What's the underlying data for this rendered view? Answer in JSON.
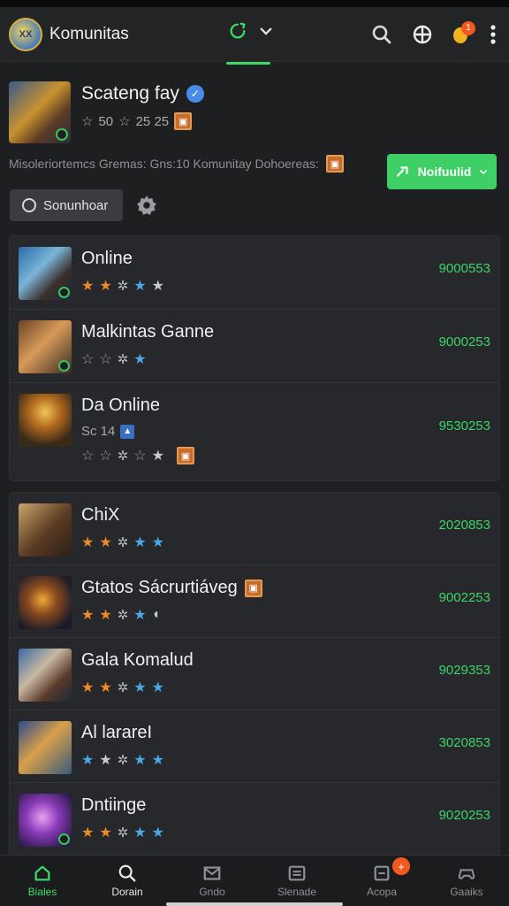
{
  "app": {
    "title": "Komunitas",
    "logo_text": "XX"
  },
  "header": {
    "notification_count": "1"
  },
  "profile": {
    "name": "Scateng fay",
    "stats_a": "50",
    "stats_b": "25 25",
    "follow_label": "Noifuulid"
  },
  "description": "Misoleriortemcs Gremas: Gns:10 Komunitay Dohoereas:",
  "filter": {
    "label": "Sonunhoar"
  },
  "list1": [
    {
      "name": "Online",
      "count": "9000553",
      "stars": [
        "orange",
        "orange",
        "gear",
        "blue",
        "gray"
      ],
      "badge": true,
      "thumb": "linear-gradient(135deg,#2a6aa8 0%,#7ab4d8 40%,#3a2e28 70%,#1d2a40 100%)"
    },
    {
      "name": "Malkintas Ganne",
      "count": "9000253",
      "stars": [
        "outline",
        "outline",
        "gear",
        "blue"
      ],
      "badge": true,
      "thumb": "linear-gradient(135deg,#6a4424 0%,#d89a5a 45%,#3a2a22 100%)"
    },
    {
      "name": "Da Online",
      "count": "9530253",
      "sub": "Sc 14",
      "stars": [
        "outline",
        "outline",
        "gear",
        "outline",
        "gray"
      ],
      "box": true,
      "thumb": "radial-gradient(circle at 50% 35%,#f2c35a 0%,#b26a1e 35%,#3a2a18 75%)"
    }
  ],
  "list2": [
    {
      "name": "ChiX",
      "count": "2020853",
      "stars": [
        "orange",
        "orange",
        "gear",
        "blue",
        "blue"
      ],
      "thumb": "linear-gradient(135deg,#c8a46a 0%,#5a3a22 55%,#2a2018 100%)"
    },
    {
      "name": "Gtatos Sácrurtiáveg",
      "count": "9002253",
      "stars": [
        "orange",
        "orange",
        "gear",
        "blue",
        "shield"
      ],
      "box": true,
      "thumb": "radial-gradient(circle at 45% 45%,#f0a83a 0%,#8a4a1e 35%,#1a1a2a 80%)"
    },
    {
      "name": "Gala Komalud",
      "count": "9029353",
      "stars": [
        "orange",
        "orange",
        "gear",
        "blue",
        "blue"
      ],
      "thumb": "linear-gradient(135deg,#3a6aa8 0%,#c8b8a0 40%,#5a3a2a 70%,#1a2a3a 100%)"
    },
    {
      "name": "Al larareI",
      "count": "3020853",
      "stars": [
        "blue",
        "gray",
        "gear",
        "blue",
        "blue"
      ],
      "thumb": "linear-gradient(135deg,#2a4a8a 0%,#d8a04a 45%,#3a5a7a 100%)"
    },
    {
      "name": "Dntiinge",
      "count": "9020253",
      "stars": [
        "orange",
        "orange",
        "gear",
        "blue",
        "blue"
      ],
      "badge": true,
      "thumb": "radial-gradient(circle at 45% 45%,#e8a0f0 0%,#8a3ab8 40%,#2a1a4a 85%)"
    }
  ],
  "nav": [
    {
      "label": "Biales",
      "icon": "home-icon",
      "state": "active"
    },
    {
      "label": "Dorain",
      "icon": "search-icon",
      "state": "bold"
    },
    {
      "label": "Gndo",
      "icon": "mail-icon",
      "state": ""
    },
    {
      "label": "Slenade",
      "icon": "list-icon",
      "state": ""
    },
    {
      "label": "Acopa",
      "icon": "document-icon",
      "state": "",
      "badge": "+"
    },
    {
      "label": "Gaaiks",
      "icon": "controller-icon",
      "state": ""
    }
  ],
  "colors": {
    "accent": "#3ddc68",
    "background": "#1e1f21",
    "card": "#27282b"
  }
}
